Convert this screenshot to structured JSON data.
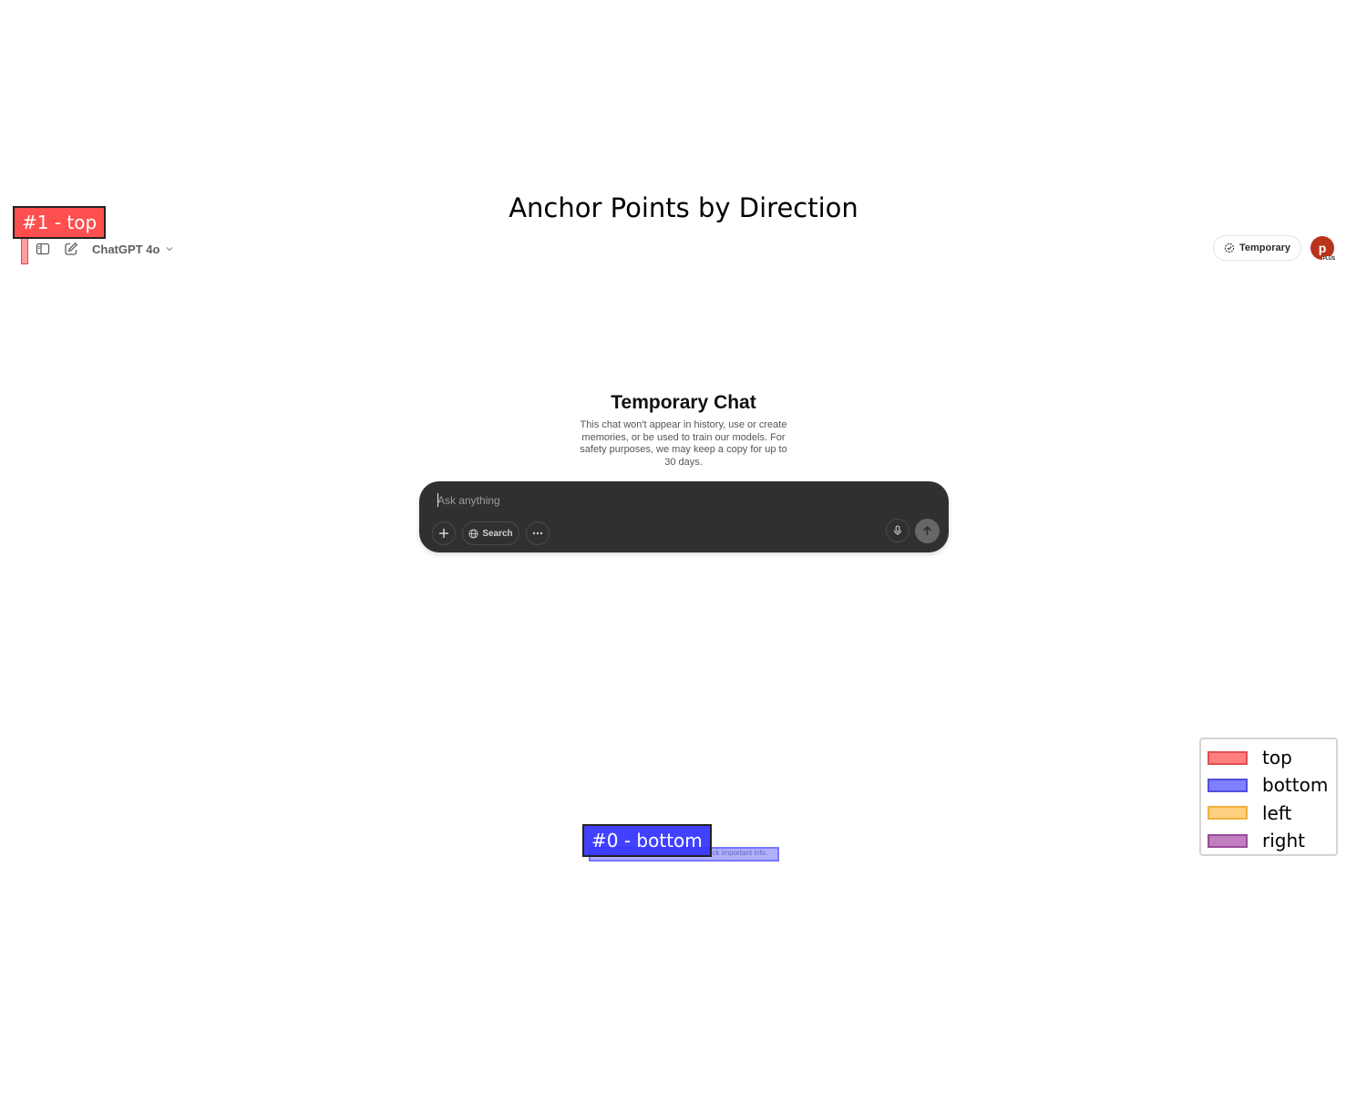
{
  "figure": {
    "title": "Anchor Points by Direction"
  },
  "topbar": {
    "model_label": "ChatGPT 4o",
    "temporary_label": "Temporary",
    "avatar_initial": "p",
    "avatar_badge": "PLUS"
  },
  "hero": {
    "title": "Temporary Chat",
    "description": "This chat won't appear in history, use or create memories, or be used to train our models. For safety purposes, we may keep a copy for up to 30 days."
  },
  "composer": {
    "placeholder": "Ask anything",
    "search_label": "Search"
  },
  "footer": {
    "disclaimer": "ChatGPT can make mistakes. Check important info.",
    "help_label": "?"
  },
  "annotations": [
    {
      "id": "#1 - top",
      "direction": "top",
      "color": "#ff4d4d"
    },
    {
      "id": "#0 - bottom",
      "direction": "bottom",
      "color": "#3d3dff"
    }
  ],
  "legend": [
    {
      "label": "top",
      "color": "#ff7f7f",
      "border": "#e05050"
    },
    {
      "label": "bottom",
      "color": "#8080ff",
      "border": "#5050e0"
    },
    {
      "label": "left",
      "color": "#ffd080",
      "border": "#f0b040"
    },
    {
      "label": "right",
      "color": "#c080c0",
      "border": "#9a4a9a"
    }
  ]
}
